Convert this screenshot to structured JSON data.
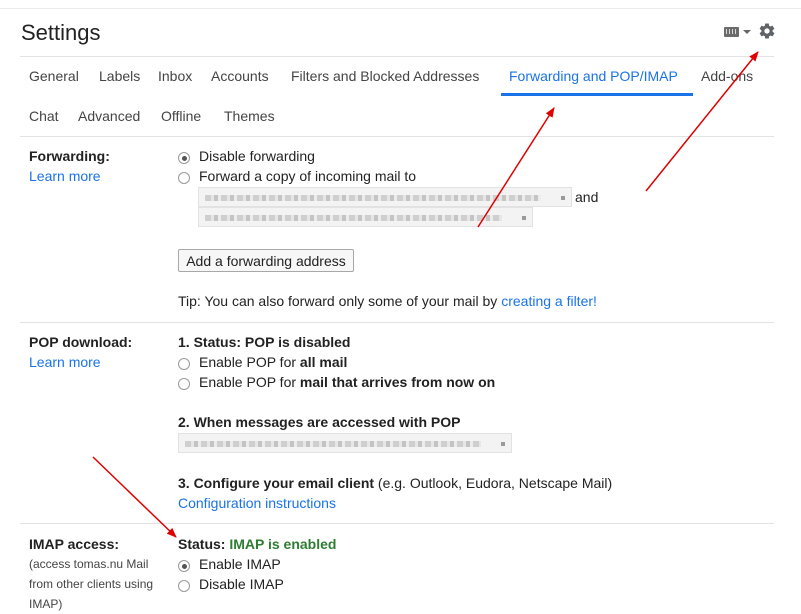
{
  "header": {
    "title": "Settings"
  },
  "tabs": [
    {
      "label": "General"
    },
    {
      "label": "Labels"
    },
    {
      "label": "Inbox"
    },
    {
      "label": "Accounts"
    },
    {
      "label": "Filters and Blocked Addresses"
    },
    {
      "label": "Forwarding and POP/IMAP",
      "active": true
    },
    {
      "label": "Add-ons"
    },
    {
      "label": "Chat"
    },
    {
      "label": "Advanced"
    },
    {
      "label": "Offline"
    },
    {
      "label": "Themes"
    }
  ],
  "forwarding": {
    "label": "Forwarding:",
    "learn_more": "Learn more",
    "option_disable": "Disable forwarding",
    "option_forward": "Forward a copy of incoming mail to",
    "and_text": "and",
    "add_button": "Add a forwarding address",
    "tip_text": "Tip: You can also forward only some of your mail by ",
    "tip_link": "creating a filter!"
  },
  "pop": {
    "label": "POP download:",
    "learn_more": "Learn more",
    "status_prefix": "1. Status: ",
    "status_value": "POP is disabled",
    "enable_all_prefix": "Enable POP for ",
    "enable_all_bold": "all mail",
    "enable_now_prefix": "Enable POP for ",
    "enable_now_bold": "mail that arrives from now on",
    "when_accessed": "2. When messages are accessed with POP",
    "configure_bold": "3. Configure your email client",
    "configure_rest": " (e.g. Outlook, Eudora, Netscape Mail)",
    "config_link": "Configuration instructions"
  },
  "imap": {
    "label": "IMAP access:",
    "note_line1": "(access tomas.nu Mail",
    "note_line2": "from other clients using",
    "note_line3": "IMAP)",
    "status_prefix": "Status: ",
    "status_value": "IMAP is enabled",
    "enable": "Enable IMAP",
    "disable": "Disable IMAP"
  },
  "colors": {
    "accent": "#1a73e8",
    "enabled_green": "#2e7d32",
    "annotation_red": "#e00000"
  },
  "icons": [
    "keyboard-icon",
    "dropdown-caret-icon",
    "gear-icon"
  ]
}
